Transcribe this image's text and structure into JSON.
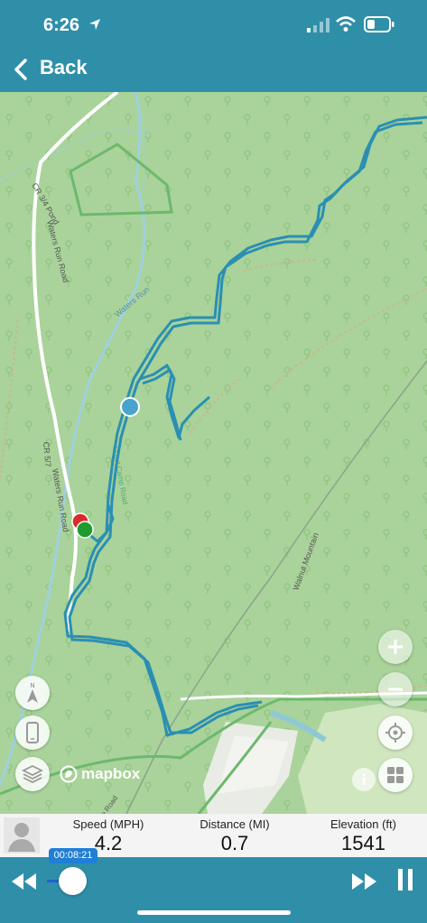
{
  "status_bar": {
    "time": "6:26"
  },
  "nav": {
    "back_label": "Back"
  },
  "map": {
    "attribution": "mapbox",
    "road_labels": [
      "CR 3/4 Pond",
      "Waters Run Road",
      "CR 5/7",
      "Waters Run Road",
      "Scout Camp Road",
      "Walnut Mountain",
      "Waters Run",
      "Old Mine Road"
    ]
  },
  "stats": [
    {
      "label": "Speed (MPH)",
      "value": "4.2"
    },
    {
      "label": "Distance (MI)",
      "value": "0.7"
    },
    {
      "label": "Elevation (ft)",
      "value": "1541"
    }
  ],
  "player": {
    "elapsed": "00:08:21",
    "progress_fraction": 0.05
  },
  "colors": {
    "accent": "#2f8fa9",
    "track": "#2b8fb3",
    "map_bg": "#a9d39a"
  }
}
